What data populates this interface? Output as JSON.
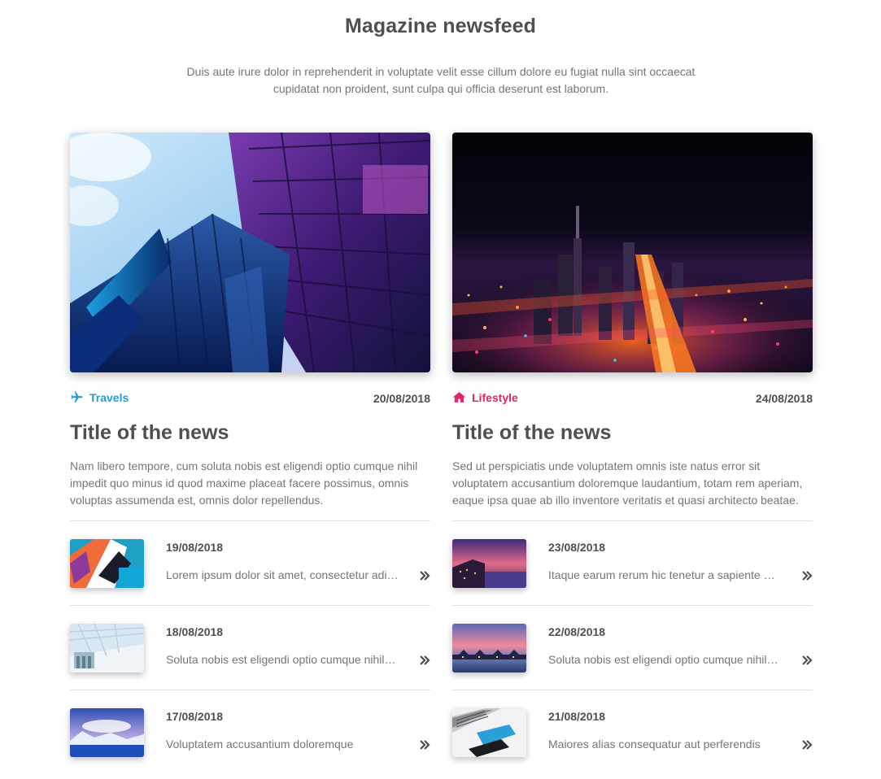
{
  "page": {
    "title": "Magazine newsfeed",
    "intro": "Duis aute irure dolor in reprehenderit in voluptate velit esse cillum dolore eu fugiat nulla sint occaecat cupidatat non proident, sunt culpa qui officia deserunt est laborum."
  },
  "colors": {
    "travels": "#1a9fd6",
    "lifestyle": "#e2256b",
    "text_dark": "#4f4f4f",
    "text_muted": "#757575"
  },
  "columns": [
    {
      "category": {
        "label": "Travels",
        "icon": "plane-icon",
        "color": "#1a9fd6"
      },
      "date": "20/08/2018",
      "title": "Title of the news",
      "text": "Nam libero tempore, cum soluta nobis est eligendi optio cumque nihil impedit quo minus id quod maxime placeat facere possimus, omnis voluptas assumenda est, omnis dolor repellendus.",
      "items": [
        {
          "date": "19/08/2018",
          "text": "Lorem ipsum dolor sit amet, consectetur adipisicing elit"
        },
        {
          "date": "18/08/2018",
          "text": "Soluta nobis est eligendi optio cumque nihil impedit"
        },
        {
          "date": "17/08/2018",
          "text": "Voluptatem accusantium doloremque"
        }
      ]
    },
    {
      "category": {
        "label": "Lifestyle",
        "icon": "home-icon",
        "color": "#e2256b"
      },
      "date": "24/08/2018",
      "title": "Title of the news",
      "text": "Sed ut perspiciatis unde voluptatem omnis iste natus error sit voluptatem accusantium doloremque laudantium, totam rem aperiam, eaque ipsa quae ab illo inventore veritatis et quasi architecto beatae.",
      "items": [
        {
          "date": "23/08/2018",
          "text": "Itaque earum rerum hic tenetur a sapiente delectus"
        },
        {
          "date": "22/08/2018",
          "text": "Soluta nobis est eligendi optio cumque nihil impedit"
        },
        {
          "date": "21/08/2018",
          "text": "Maiores alias consequatur aut perferendis"
        }
      ]
    }
  ]
}
